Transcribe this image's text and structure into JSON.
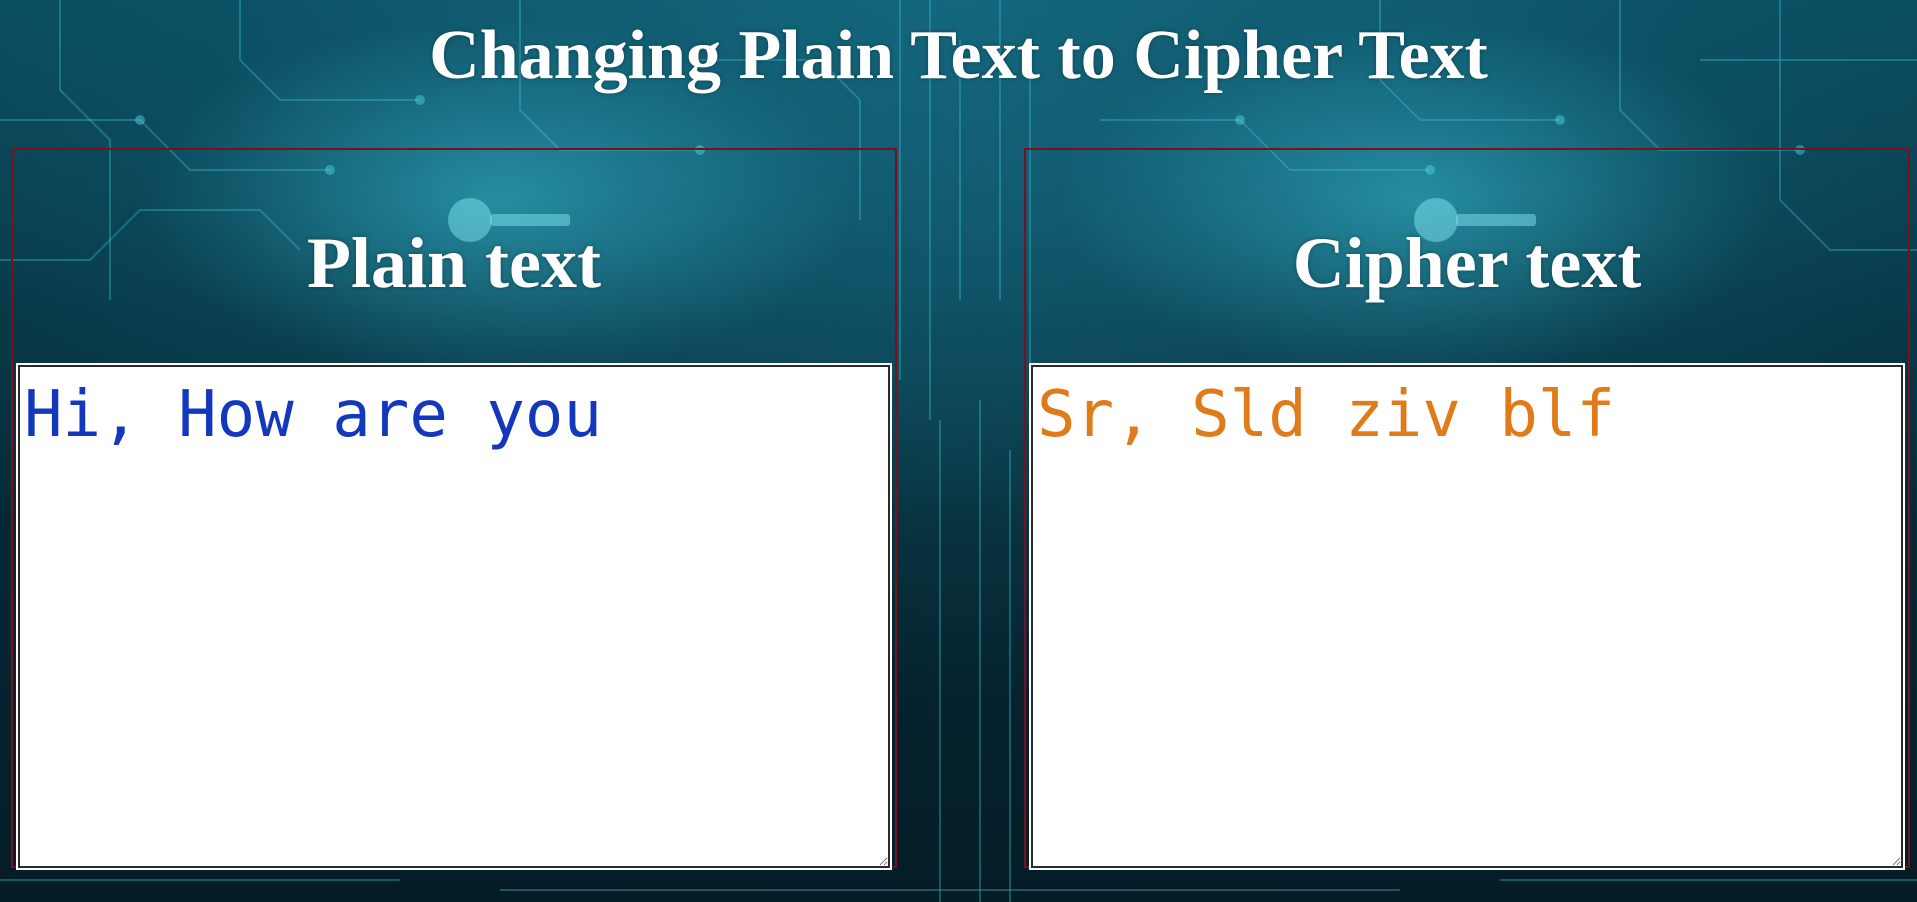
{
  "page": {
    "title": "Changing Plain Text to Cipher Text"
  },
  "plain_panel": {
    "heading": "Plain text",
    "value": "Hi, How are you",
    "text_color": "#1338be"
  },
  "cipher_panel": {
    "heading": "Cipher text",
    "value": "Sr, Sld ziv blf",
    "text_color": "#e07b1a"
  },
  "theme": {
    "panel_border_color": "#7a0f1e",
    "background": "circuit-board-key-image"
  }
}
